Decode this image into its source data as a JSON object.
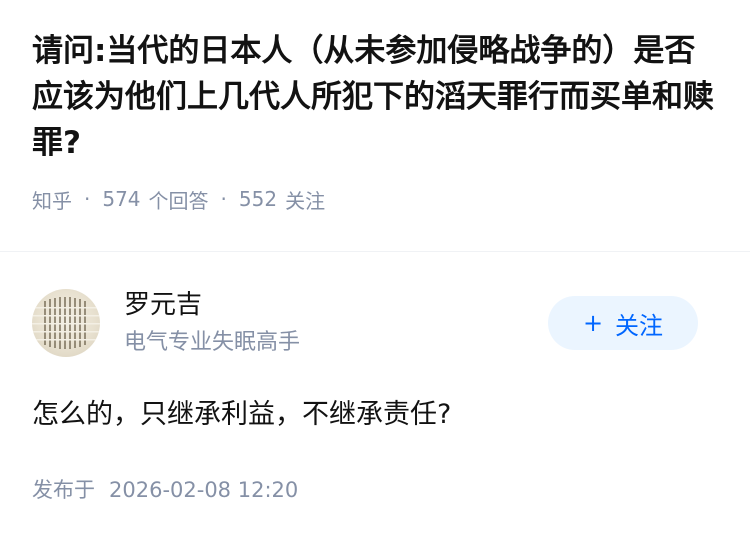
{
  "question": {
    "title": "请问:当代的日本人（从未参加侵略战争的）是否应该为他们上几代人所犯下的滔天罪行而买单和赎罪?",
    "source": "知乎",
    "answer_count": "574",
    "answer_label": "个回答",
    "follow_count": "552",
    "follow_label": "关注"
  },
  "author": {
    "name": "罗元吉",
    "bio": "电气专业失眠高手",
    "avatar_icon": "calligraphy-avatar",
    "follow_button": {
      "icon": "plus-icon",
      "plus": "+",
      "label": "关注",
      "bg_color": "#ebf5ff",
      "text_color": "#0066ff"
    }
  },
  "answer": {
    "content": "怎么的，只继承利益，不继承责任?",
    "publish_label": "发布于",
    "publish_time": "2026-02-08 12:20"
  }
}
